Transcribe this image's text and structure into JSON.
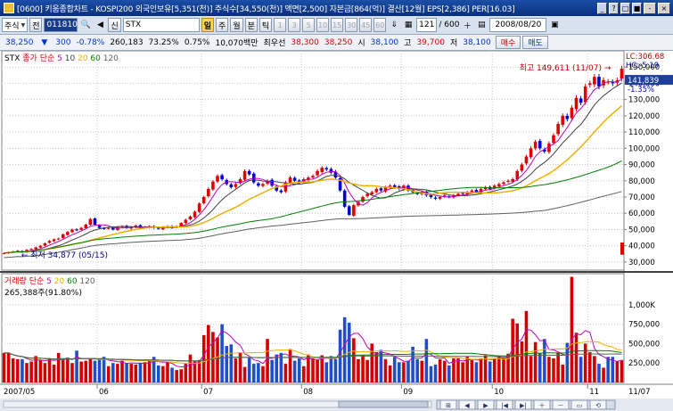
{
  "window": {
    "title": "[0600] 키움종합차트 - KOSPI200 외국인보유[5,351(천)] 주식수[34,550(천)] 액면[2,500] 자본금[864(억)] 결산[12월] EPS[2,386] PER[16.03]",
    "buttons": [
      "_",
      "?",
      "□",
      "■",
      "-",
      "×"
    ]
  },
  "toolbar": {
    "market": "주식",
    "prev_btn": "전",
    "code": "011810",
    "search_icon": "돋",
    "audio_icon": "◀",
    "new_label": "신",
    "stock_name": "STX",
    "period_buttons": [
      "일",
      "주",
      "월",
      "분",
      "틱"
    ],
    "active_period": "일",
    "minute_buttons": [
      "1",
      "3",
      "5",
      "10",
      "15",
      "30",
      "45",
      "60"
    ],
    "count_value": "121",
    "count_total": "/ 600",
    "date": "2008/08/20"
  },
  "quote": {
    "price": "38,250",
    "price_arrow": "▼",
    "change": "300",
    "change_pct": "-0.78%",
    "volume": "260,183",
    "vol_ratio": "73.25%",
    "turnover": "0.75%",
    "amount": "10,070백만",
    "best_label": "최우선",
    "ask": "38,300",
    "bid": "38,250",
    "open_label": "시",
    "open": "38,100",
    "high_label": "고",
    "high": "39,700",
    "low_label": "저",
    "low": "38,100",
    "buy_btn": "매수",
    "sell_btn": "매도"
  },
  "chart_data": [
    {
      "type": "candlestick",
      "title": "STX",
      "legend": [
        "종가",
        "단순",
        "5",
        "10",
        "20",
        "60",
        "120"
      ],
      "legend_colors": [
        "#d40000",
        "#d40000",
        "#c000c0",
        "#404040",
        "#f0b000",
        "#008000",
        "#606060"
      ],
      "ylim": [
        25000,
        160000
      ],
      "yticks": [
        30000,
        40000,
        50000,
        60000,
        70000,
        80000,
        90000,
        100000,
        110000,
        120000,
        130000,
        140000,
        150000
      ],
      "ytick_labels": [
        "30,000",
        "40,000",
        "50,000",
        "60,000",
        "70,000",
        "80,000",
        "90,000",
        "100,000",
        "110,000",
        "120,000",
        "130,000",
        "140,000",
        "150,000"
      ],
      "x_labels": [
        "2007/05",
        "06",
        "07",
        "08",
        "09",
        "10",
        "11",
        "11/07"
      ],
      "x_label_index": [
        0,
        21,
        44,
        66,
        88,
        108,
        129,
        136
      ],
      "close": [
        35500,
        36000,
        36500,
        37000,
        36000,
        37500,
        38000,
        39000,
        40000,
        41500,
        43000,
        44000,
        44500,
        47000,
        48500,
        50000,
        49500,
        51000,
        53000,
        56500,
        53000,
        51000,
        50500,
        51000,
        50000,
        51500,
        52000,
        51000,
        51500,
        52500,
        51000,
        51500,
        52000,
        51000,
        50500,
        51500,
        52000,
        51000,
        52000,
        54000,
        56000,
        58000,
        61000,
        66000,
        70000,
        75000,
        79500,
        83000,
        81000,
        78000,
        76000,
        78000,
        81000,
        86000,
        84000,
        79000,
        77000,
        78000,
        80000,
        77000,
        74000,
        73000,
        79000,
        82000,
        80000,
        79000,
        81000,
        82000,
        83000,
        86000,
        88000,
        87000,
        85000,
        82000,
        74000,
        64000,
        59000,
        65000,
        67000,
        70000,
        72000,
        73000,
        75000,
        74000,
        76000,
        77000,
        76000,
        75000,
        77000,
        74000,
        73000,
        72000,
        73000,
        71000,
        70000,
        69000,
        70000,
        71000,
        70000,
        71000,
        72000,
        72000,
        73000,
        74000,
        73000,
        75000,
        76000,
        75000,
        77000,
        78000,
        79000,
        80000,
        81000,
        86000,
        90000,
        95000,
        100000,
        104000,
        100000,
        98000,
        103000,
        108000,
        115000,
        120000,
        118000,
        125000,
        131000,
        128000,
        138000,
        140000,
        144000,
        138000,
        142000,
        141000,
        140000,
        141839,
        149000
      ],
      "volume": [
        380000,
        380000,
        310000,
        300000,
        300000,
        250000,
        270000,
        340000,
        290000,
        250000,
        310000,
        230000,
        380000,
        290000,
        320000,
        250000,
        410000,
        270000,
        280000,
        310000,
        280000,
        310000,
        330000,
        210000,
        250000,
        240000,
        280000,
        250000,
        240000,
        230000,
        250000,
        260000,
        290000,
        330000,
        220000,
        210000,
        270000,
        190000,
        160000,
        170000,
        240000,
        360000,
        270000,
        290000,
        610000,
        740000,
        650000,
        580000,
        750000,
        470000,
        490000,
        310000,
        380000,
        200000,
        320000,
        240000,
        250000,
        210000,
        560000,
        290000,
        360000,
        380000,
        240000,
        430000,
        280000,
        310000,
        210000,
        360000,
        310000,
        290000,
        350000,
        260000,
        340000,
        300000,
        680000,
        840000,
        770000,
        570000,
        300000,
        350000,
        290000,
        500000,
        390000,
        420000,
        300000,
        220000,
        330000,
        260000,
        260000,
        280000,
        460000,
        300000,
        280000,
        560000,
        210000,
        230000,
        300000,
        280000,
        220000,
        310000,
        310000,
        260000,
        330000,
        290000,
        260000,
        310000,
        350000,
        270000,
        310000,
        340000,
        310000,
        370000,
        820000,
        760000,
        530000,
        920000,
        340000,
        520000,
        380000,
        560000,
        330000,
        310000,
        380000,
        230000,
        510000,
        1360000,
        640000,
        330000,
        500000,
        390000,
        340000,
        240000,
        190000,
        330000,
        330000,
        270000,
        290000
      ],
      "volume_ylim": [
        0,
        1400000
      ],
      "volume_yticks": [
        250000,
        500000,
        750000,
        1000000
      ],
      "volume_ytick_labels": [
        "250,000",
        "500,000",
        "750,000",
        "1,000K"
      ],
      "annotations": {
        "high_label": "최고 149,611 (11/07)",
        "low_label": "최저 34,877 (05/15)",
        "last_price": "141,839",
        "lc": "LC:306.68",
        "hc": "HC:-5.19",
        "pct": "-1.35%"
      }
    },
    {
      "type": "bar",
      "title": "거래량",
      "legend": [
        "거래량",
        "단순",
        "5",
        "20",
        "60",
        "120"
      ],
      "legend_colors": [
        "#d40000",
        "#d40000",
        "#c000c0",
        "#f0b000",
        "#008000",
        "#606060"
      ],
      "subtitle": "265,388주(91.80%)"
    }
  ]
}
